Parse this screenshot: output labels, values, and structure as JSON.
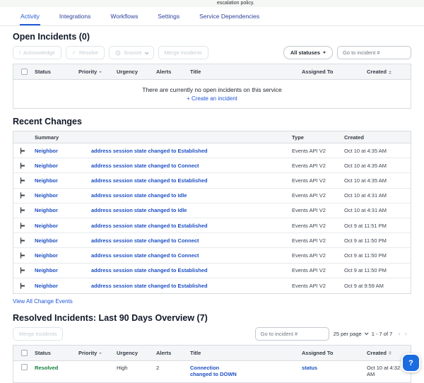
{
  "page": {
    "context_text": "escalation policy."
  },
  "tabs": [
    {
      "label": "Activity"
    },
    {
      "label": "Integrations"
    },
    {
      "label": "Workflows"
    },
    {
      "label": "Settings"
    },
    {
      "label": "Service Dependencies"
    }
  ],
  "open_incidents": {
    "title": "Open Incidents (0)",
    "buttons": {
      "acknowledge": "Acknowledge",
      "resolve": "Resolve",
      "snooze": "Snooze",
      "merge": "Merge Incidents",
      "all_statuses": "All statuses"
    },
    "goto_placeholder": "Go to incident #",
    "columns": {
      "status": "Status",
      "priority": "Priority",
      "urgency": "Urgency",
      "alerts": "Alerts",
      "title": "Title",
      "assigned_to": "Assigned To",
      "created": "Created"
    },
    "empty_message": "There are currently no open incidents on this service",
    "create_link": "+ Create an incident"
  },
  "recent_changes": {
    "title": "Recent Changes",
    "columns": {
      "summary": "Summary",
      "type": "Type",
      "created": "Created"
    },
    "rows": [
      {
        "source": "Neighbor",
        "summary": "address session state changed to Established",
        "type": "Events API V2",
        "created": "Oct 10 at 4:35 AM"
      },
      {
        "source": "Neighbor",
        "summary": "address session state changed to Connect",
        "type": "Events API V2",
        "created": "Oct 10 at 4:35 AM"
      },
      {
        "source": "Neighbor",
        "summary": "address session state changed to Established",
        "type": "Events API V2",
        "created": "Oct 10 at 4:35 AM"
      },
      {
        "source": "Neighbor",
        "summary": "address session state changed to Idle",
        "type": "Events API V2",
        "created": "Oct 10 at 4:31 AM"
      },
      {
        "source": "Neighbor",
        "summary": "address session state changed to Idle",
        "type": "Events API V2",
        "created": "Oct 10 at 4:31 AM"
      },
      {
        "source": "Neighbor",
        "summary": "address session state changed to Established",
        "type": "Events API V2",
        "created": "Oct 9 at 11:51 PM"
      },
      {
        "source": "Neighbor",
        "summary": "address session state changed to Connect",
        "type": "Events API V2",
        "created": "Oct 9 at 11:50 PM"
      },
      {
        "source": "Neighbor",
        "summary": "address session state changed to Connect",
        "type": "Events API V2",
        "created": "Oct 9 at 11:50 PM"
      },
      {
        "source": "Neighbor",
        "summary": "address session state changed to Established",
        "type": "Events API V2",
        "created": "Oct 9 at 11:50 PM"
      },
      {
        "source": "Neighbor",
        "summary": "address session state changed to Established",
        "type": "Events API V2",
        "created": "Oct 9 at 9:59 AM"
      }
    ],
    "view_all": "View All Change Events"
  },
  "resolved_incidents": {
    "title": "Resolved Incidents: Last 90 Days Overview (7)",
    "buttons": {
      "merge": "Merge Incidents"
    },
    "goto_placeholder": "Go to incident #",
    "pagination": {
      "per_page": "25 per page",
      "range": "1 - 7 of 7",
      "prev": "‹",
      "next": "›"
    },
    "columns": {
      "status": "Status",
      "priority": "Priority",
      "urgency": "Urgency",
      "alerts": "Alerts",
      "title": "Title",
      "assigned_to": "Assigned To",
      "created": "Created"
    },
    "rows": [
      {
        "status": "Resolved",
        "priority": "",
        "urgency": "High",
        "alerts": "2",
        "title": "Connection changed to DOWN",
        "assigned_to": "status",
        "created": "Oct 10 at 4:32 AM"
      }
    ]
  },
  "icons": {
    "acknowledge": "!",
    "resolve": "✓",
    "help": "?"
  }
}
